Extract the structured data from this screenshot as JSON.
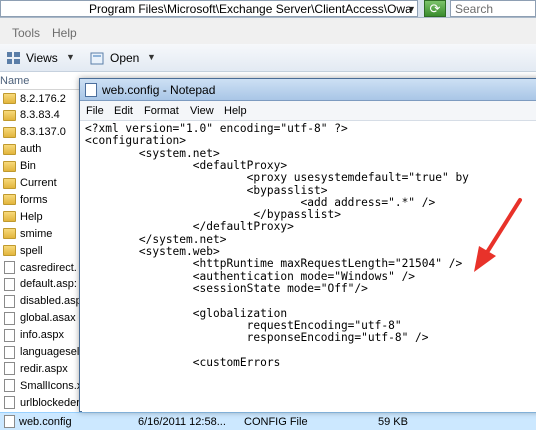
{
  "address_bar": {
    "path": "Program Files\\Microsoft\\Exchange Server\\ClientAccess\\Owa",
    "search_placeholder": "Search"
  },
  "explorer_menu": [
    "Tools",
    "Help"
  ],
  "toolbar": {
    "views_label": "Views",
    "open_label": "Open"
  },
  "column_header": {
    "name": "Name"
  },
  "files": [
    {
      "name": "8.2.176.2",
      "type": "folder"
    },
    {
      "name": "8.3.83.4",
      "type": "folder"
    },
    {
      "name": "8.3.137.0",
      "type": "folder"
    },
    {
      "name": "auth",
      "type": "folder"
    },
    {
      "name": "Bin",
      "type": "folder"
    },
    {
      "name": "Current",
      "type": "folder"
    },
    {
      "name": "forms",
      "type": "folder"
    },
    {
      "name": "Help",
      "type": "folder"
    },
    {
      "name": "smime",
      "type": "folder"
    },
    {
      "name": "spell",
      "type": "folder"
    },
    {
      "name": "casredirect.",
      "type": "file"
    },
    {
      "name": "default.asp:",
      "type": "file"
    },
    {
      "name": "disabled.asp",
      "type": "file"
    },
    {
      "name": "global.asax",
      "type": "file"
    },
    {
      "name": "info.aspx",
      "type": "file"
    },
    {
      "name": "languagesel",
      "type": "file"
    },
    {
      "name": "redir.aspx",
      "type": "file"
    },
    {
      "name": "SmallIcons.x",
      "type": "file"
    },
    {
      "name": "urlblockeder",
      "type": "file"
    }
  ],
  "selected_file": {
    "name": "web.config",
    "date": "6/16/2011 12:58...",
    "type": "CONFIG File",
    "size": "59 KB"
  },
  "notepad": {
    "title": "web.config - Notepad",
    "menu": [
      "File",
      "Edit",
      "Format",
      "View",
      "Help"
    ],
    "lines": [
      "<?xml version=\"1.0\" encoding=\"utf-8\" ?>",
      "<configuration>",
      "        <system.net>",
      "                <defaultProxy>",
      "                        <proxy usesystemdefault=\"true\" by",
      "                        <bypasslist>",
      "                                <add address=\".*\" />",
      "                         </bypasslist>",
      "                </defaultProxy>",
      "        </system.net>",
      "        <system.web>",
      "                <httpRuntime maxRequestLength=\"21504\" />",
      "                <authentication mode=\"Windows\" />",
      "                <sessionState mode=\"Off\"/>",
      "",
      "                <globalization",
      "                        requestEncoding=\"utf-8\"",
      "                        responseEncoding=\"utf-8\" />",
      "",
      "                <customErrors"
    ]
  },
  "colors": {
    "annotation_arrow": "#e8322a",
    "selection": "#cce8ff"
  }
}
